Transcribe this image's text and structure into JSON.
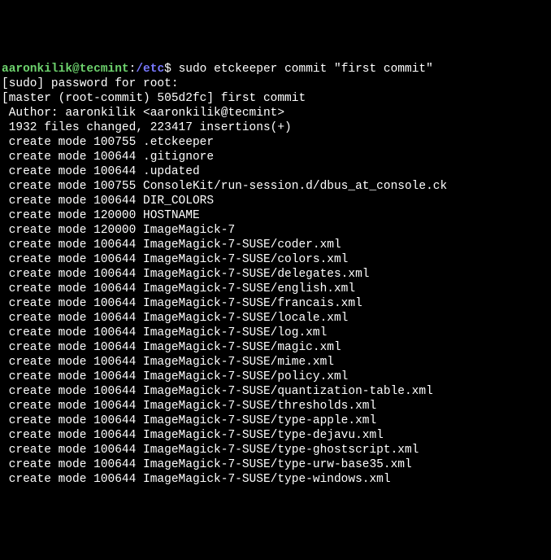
{
  "prompt": {
    "user_host": "aaronkilik@tecmint",
    "cwd": "/etc",
    "symbol": "$",
    "command": "sudo etckeeper commit \"first commit\""
  },
  "sudo_line": "[sudo] password for root:",
  "commit_line": "[master (root-commit) 505d2fc] first commit",
  "author_line": " Author: aaronkilik <aaronkilik@tecmint>",
  "stats_line": " 1932 files changed, 223417 insertions(+)",
  "entries": [
    " create mode 100755 .etckeeper",
    " create mode 100644 .gitignore",
    " create mode 100644 .updated",
    " create mode 100755 ConsoleKit/run-session.d/dbus_at_console.ck",
    " create mode 100644 DIR_COLORS",
    " create mode 120000 HOSTNAME",
    " create mode 120000 ImageMagick-7",
    " create mode 100644 ImageMagick-7-SUSE/coder.xml",
    " create mode 100644 ImageMagick-7-SUSE/colors.xml",
    " create mode 100644 ImageMagick-7-SUSE/delegates.xml",
    " create mode 100644 ImageMagick-7-SUSE/english.xml",
    " create mode 100644 ImageMagick-7-SUSE/francais.xml",
    " create mode 100644 ImageMagick-7-SUSE/locale.xml",
    " create mode 100644 ImageMagick-7-SUSE/log.xml",
    " create mode 100644 ImageMagick-7-SUSE/magic.xml",
    " create mode 100644 ImageMagick-7-SUSE/mime.xml",
    " create mode 100644 ImageMagick-7-SUSE/policy.xml",
    " create mode 100644 ImageMagick-7-SUSE/quantization-table.xml",
    " create mode 100644 ImageMagick-7-SUSE/thresholds.xml",
    " create mode 100644 ImageMagick-7-SUSE/type-apple.xml",
    " create mode 100644 ImageMagick-7-SUSE/type-dejavu.xml",
    " create mode 100644 ImageMagick-7-SUSE/type-ghostscript.xml",
    " create mode 100644 ImageMagick-7-SUSE/type-urw-base35.xml",
    " create mode 100644 ImageMagick-7-SUSE/type-windows.xml"
  ]
}
